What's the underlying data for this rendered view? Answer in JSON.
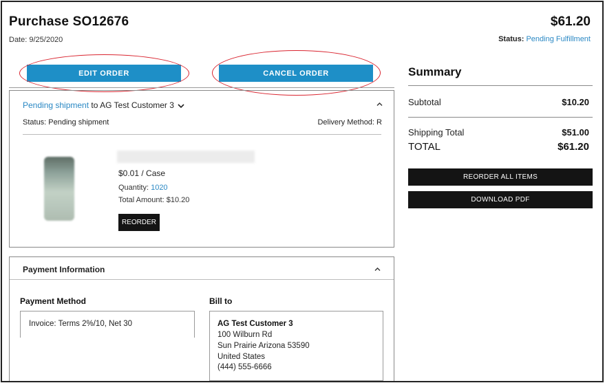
{
  "order": {
    "title": "Purchase SO12676",
    "date_label": "Date: ",
    "date_value": "9/25/2020",
    "total": "$61.20",
    "status_label": "Status:",
    "status_value": "Pending Fulfillment"
  },
  "actions": {
    "edit_label": "EDIT ORDER",
    "cancel_label": "CANCEL ORDER",
    "highlight_color": "#d9232e",
    "button_color": "#1e8fc7"
  },
  "shipment": {
    "status_link": "Pending shipment",
    "to_text": " to AG Test Customer 3",
    "chevron_icon": "chevron-down-icon",
    "collapse_icon": "chevron-up-icon",
    "status_line": "Status: Pending shipment",
    "delivery_line": "Delivery Method: R",
    "item": {
      "price": "$0.01 / Case",
      "quantity_label": "Quantity: ",
      "quantity_value": "1020",
      "total_amount": "Total Amount: $10.20",
      "reorder_label": "REORDER"
    }
  },
  "payment": {
    "heading": "Payment Information",
    "method_label": "Payment Method",
    "method_value": "Invoice: Terms 2%/10, Net 30",
    "bill_to_label": "Bill to",
    "bill_to": {
      "name": "AG Test Customer 3",
      "street": "100 Wilburn Rd",
      "city_line": "Sun Prairie Arizona 53590",
      "country": "United States",
      "phone": "(444) 555-6666"
    }
  },
  "summary": {
    "title": "Summary",
    "subtotal_label": "Subtotal",
    "subtotal_value": "$10.20",
    "shipping_label": "Shipping Total",
    "shipping_value": "$51.00",
    "total_label": "TOTAL",
    "total_value": "$61.20",
    "reorder_all_label": "REORDER ALL ITEMS",
    "download_label": "DOWNLOAD PDF"
  }
}
